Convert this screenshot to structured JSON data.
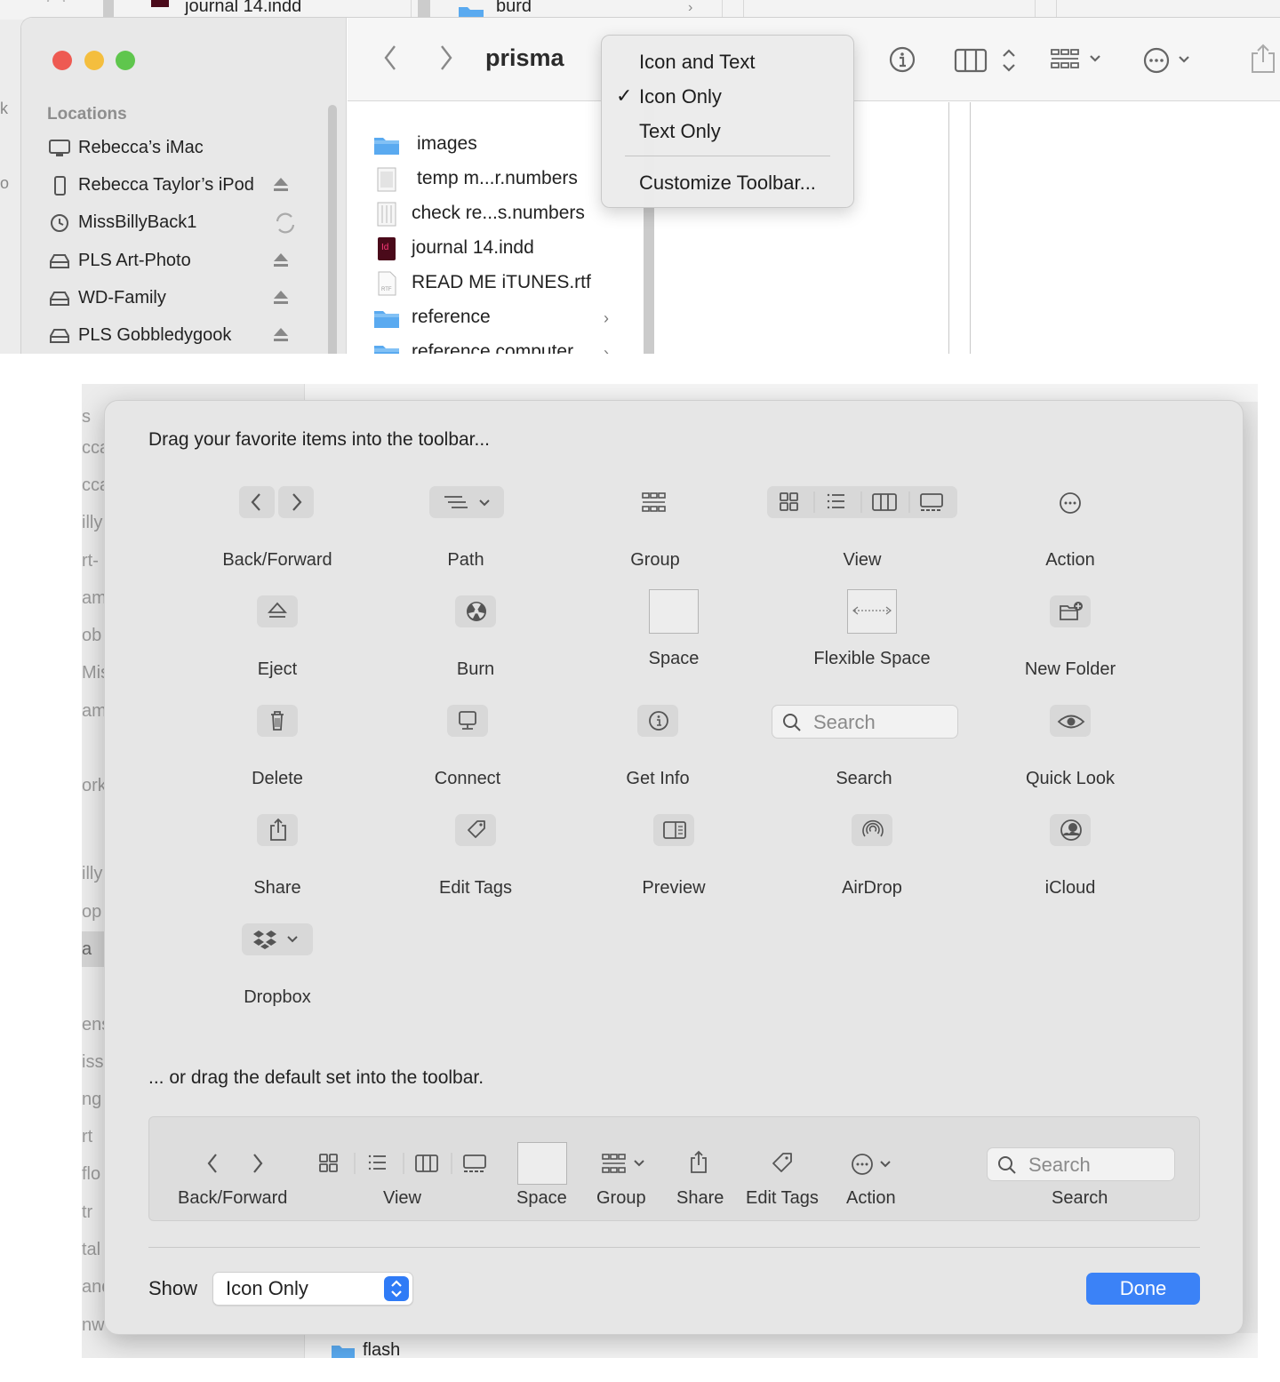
{
  "background_strip": {
    "file_left": "journal 14.indd",
    "folder_right": "burd"
  },
  "finder": {
    "title": "prisma",
    "sidebar": {
      "section": "Locations",
      "items": [
        {
          "label": "Rebecca’s iMac",
          "icon": "imac-icon",
          "trailing": ""
        },
        {
          "label": "Rebecca Taylor’s iPod",
          "icon": "ipod-icon",
          "trailing": "eject-icon"
        },
        {
          "label": "MissBillyBack1",
          "icon": "time-machine-icon",
          "trailing": "sync-icon"
        },
        {
          "label": "PLS Art-Photo",
          "icon": "drive-icon",
          "trailing": "eject-icon"
        },
        {
          "label": "WD-Family",
          "icon": "drive-icon",
          "trailing": "eject-icon"
        },
        {
          "label": "PLS Gobbledygook",
          "icon": "drive-icon",
          "trailing": "eject-icon"
        }
      ]
    },
    "files": [
      {
        "name": "images",
        "icon": "folder-icon",
        "chevron": false
      },
      {
        "name": "temp m...r.numbers",
        "icon": "numbers-file-icon",
        "chevron": false
      },
      {
        "name": "check re...s.numbers",
        "icon": "numbers-file-icon",
        "chevron": false
      },
      {
        "name": "journal 14.indd",
        "icon": "indesign-file-icon",
        "chevron": false
      },
      {
        "name": "READ ME iTUNES.rtf",
        "icon": "rtf-file-icon",
        "chevron": false
      },
      {
        "name": "reference",
        "icon": "folder-icon",
        "chevron": true
      },
      {
        "name": "reference computer",
        "icon": "folder-icon",
        "chevron": true
      }
    ],
    "context_menu": {
      "items": [
        "Icon and Text",
        "Icon Only",
        "Text Only"
      ],
      "checked": "Icon Only",
      "customize": "Customize Toolbar..."
    }
  },
  "customize": {
    "heading": "Drag your favorite items into the toolbar...",
    "items": [
      {
        "label": "Back/Forward",
        "icon": "back-forward-icon"
      },
      {
        "label": "Path",
        "icon": "path-icon"
      },
      {
        "label": "Group",
        "icon": "group-icon"
      },
      {
        "label": "View",
        "icon": "view-icon"
      },
      {
        "label": "Action",
        "icon": "action-icon"
      },
      {
        "label": "Eject",
        "icon": "eject-icon"
      },
      {
        "label": "Burn",
        "icon": "burn-icon"
      },
      {
        "label": "Space",
        "icon": "space-icon"
      },
      {
        "label": "Flexible Space",
        "icon": "flexible-space-icon"
      },
      {
        "label": "New Folder",
        "icon": "new-folder-icon"
      },
      {
        "label": "Delete",
        "icon": "trash-icon"
      },
      {
        "label": "Connect",
        "icon": "connect-icon"
      },
      {
        "label": "Get Info",
        "icon": "info-icon"
      },
      {
        "label": "Search",
        "icon": "search-icon"
      },
      {
        "label": "Quick Look",
        "icon": "eye-icon"
      },
      {
        "label": "Share",
        "icon": "share-icon"
      },
      {
        "label": "Edit Tags",
        "icon": "tag-icon"
      },
      {
        "label": "Preview",
        "icon": "preview-icon"
      },
      {
        "label": "AirDrop",
        "icon": "airdrop-icon"
      },
      {
        "label": "iCloud",
        "icon": "icloud-icon"
      },
      {
        "label": "Dropbox",
        "icon": "dropbox-icon"
      }
    ],
    "search_placeholder": "Search",
    "default_heading": "... or drag the default set into the toolbar.",
    "default_set": [
      "Back/Forward",
      "View",
      "Space",
      "Group",
      "Share",
      "Edit Tags",
      "Action",
      "Search"
    ],
    "show_label": "Show",
    "show_value": "Icon Only",
    "done_label": "Done"
  },
  "behind_sidebar_fragments": [
    "s",
    "cca",
    "cca",
    "illy",
    "rt-",
    "am",
    "ob",
    "Mis",
    "am",
    "ork",
    "illy",
    "op",
    "a",
    "ens",
    "iss",
    "ng",
    "rt",
    "flo",
    "tr",
    "tal",
    "and",
    "nw"
  ],
  "behind_bottom_folder": "flash",
  "colors": {
    "accent": "#3b82f7",
    "close": "#ee5a52",
    "minimize": "#f4be3e",
    "zoom": "#5fc64d",
    "folder": "#5aaaf0"
  }
}
